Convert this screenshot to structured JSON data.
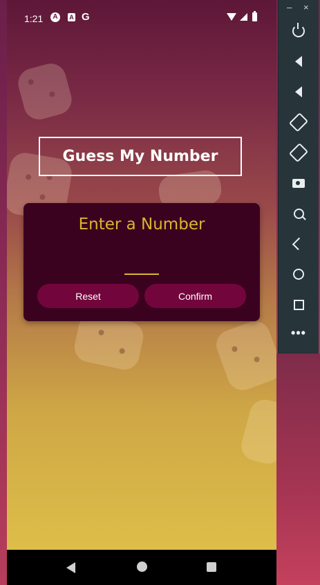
{
  "status_bar": {
    "time": "1:21",
    "icons": [
      "app-a-icon",
      "app-b-icon",
      "google-icon",
      "wifi-icon",
      "signal-icon",
      "battery-icon"
    ],
    "google_glyph": "G"
  },
  "app": {
    "title": "Guess My Number",
    "input_card": {
      "label": "Enter a Number",
      "input_value": "",
      "reset_label": "Reset",
      "confirm_label": "Confirm"
    },
    "colors": {
      "card_background": "#3b0220",
      "accent": "#ddb52f",
      "button": "#72063c",
      "title_text": "#ffffff"
    }
  },
  "nav_bar": {
    "buttons": [
      "back-icon",
      "home-icon",
      "recents-icon"
    ]
  },
  "emulator_toolbar": {
    "window_controls": {
      "minimize": "–",
      "close": "×"
    },
    "buttons": [
      "power-icon",
      "volume-up-icon",
      "volume-down-icon",
      "rotate-left-icon",
      "rotate-right-icon",
      "screenshot-icon",
      "zoom-icon",
      "back-icon",
      "home-icon",
      "overview-icon",
      "more-icon"
    ],
    "more_glyph": "•••"
  }
}
